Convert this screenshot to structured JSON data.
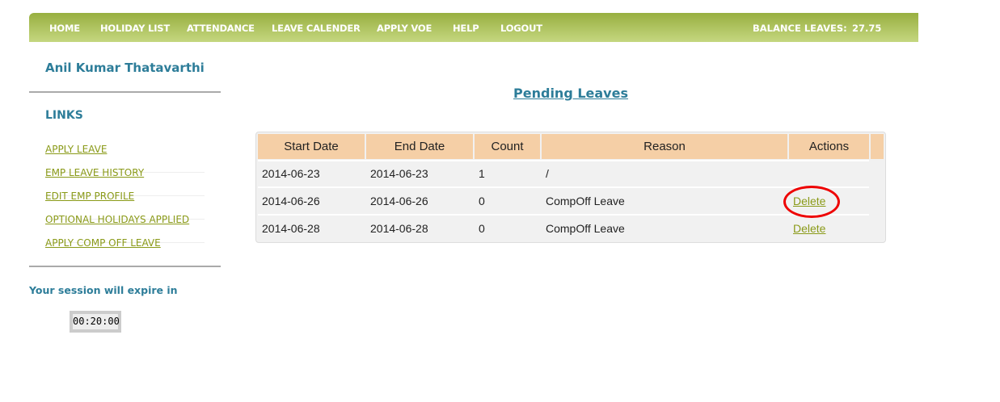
{
  "nav": {
    "items": [
      "HOME",
      "HOLIDAY LIST",
      "ATTENDANCE",
      "LEAVE CALENDER",
      "APPLY VOE",
      "HELP",
      "LOGOUT"
    ],
    "balance_label": "BALANCE LEAVES:",
    "balance_value": "27.75"
  },
  "sidebar": {
    "user_name": "Anil Kumar Thatavarthi",
    "links_heading": "LINKS",
    "links": [
      "APPLY LEAVE",
      "EMP LEAVE HISTORY",
      "EDIT EMP PROFILE",
      "OPTIONAL HOLIDAYS APPLIED",
      "APPLY COMP OFF LEAVE"
    ],
    "session_text": "Your session will expire in",
    "timer": "00:20:00"
  },
  "main": {
    "title": "Pending Leaves",
    "columns": [
      "Start Date",
      "End Date",
      "Count",
      "Reason",
      "Actions"
    ],
    "rows": [
      {
        "start": "2014-06-23",
        "end": "2014-06-23",
        "count": "1",
        "reason": "/",
        "action": ""
      },
      {
        "start": "2014-06-26",
        "end": "2014-06-26",
        "count": "0",
        "reason": "CompOff Leave",
        "action": "Delete"
      },
      {
        "start": "2014-06-28",
        "end": "2014-06-28",
        "count": "0",
        "reason": "CompOff Leave",
        "action": "Delete"
      }
    ]
  },
  "colors": {
    "nav": "#a6bb52",
    "accent": "#2d7d99",
    "link": "#8a9a18",
    "header": "#f5cfa6",
    "highlight": "#e00000"
  }
}
